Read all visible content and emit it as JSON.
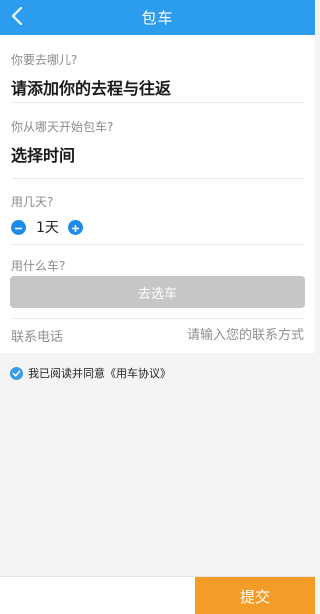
{
  "header": {
    "title": "包车",
    "back_icon": "chevron-left-icon"
  },
  "destination": {
    "label": "你要去哪儿?",
    "value": "请添加你的去程与往返"
  },
  "start_date": {
    "label": "你从哪天开始包车?",
    "value": "选择时间"
  },
  "days": {
    "label": "用几天?",
    "value": "1天",
    "minus_icon": "minus-icon",
    "plus_icon": "plus-icon"
  },
  "car": {
    "label": "用什么车?",
    "button": "去选车"
  },
  "contact": {
    "label": "联系电话",
    "placeholder": "请输入您的联系方式"
  },
  "agreement": {
    "text": "我已阅读并同意《用车协议》",
    "checked": true
  },
  "submit": {
    "label": "提交"
  },
  "colors": {
    "header": "#2c9cef",
    "stepper": "#1d8be8",
    "disabled_button": "#c6c6c6",
    "submit": "#f49c28"
  }
}
